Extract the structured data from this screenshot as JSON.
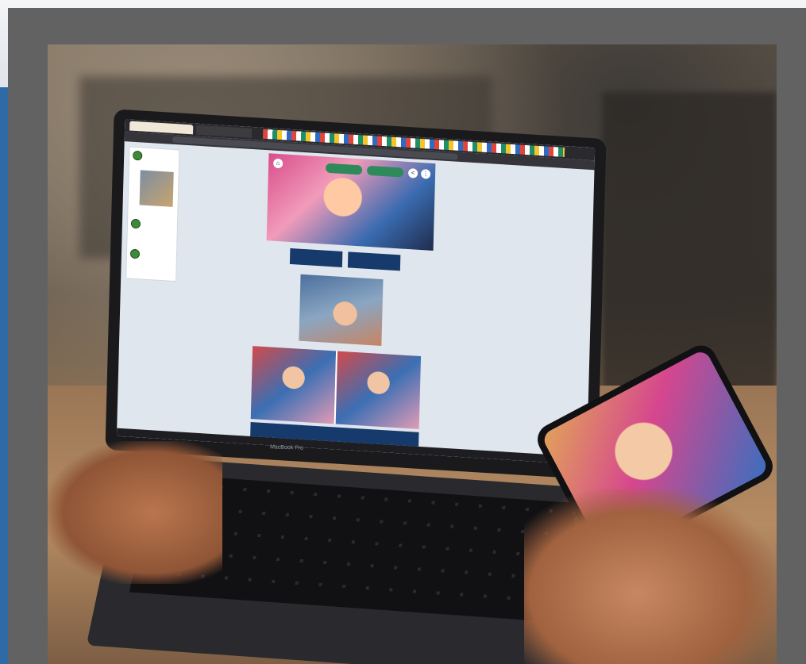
{
  "scene": {
    "description_colors": {
      "frame": "#626262",
      "blue_band": "#2d6aa6",
      "button_navy": "#163a6b",
      "button_green": "#2e8a5a"
    }
  },
  "laptop": {
    "brand_label": "MacBook Pro",
    "browser": {
      "active_tab": "",
      "second_tab": ""
    },
    "icons": {
      "home": "home-icon",
      "share": "share-icon",
      "more": "more-icon"
    }
  }
}
